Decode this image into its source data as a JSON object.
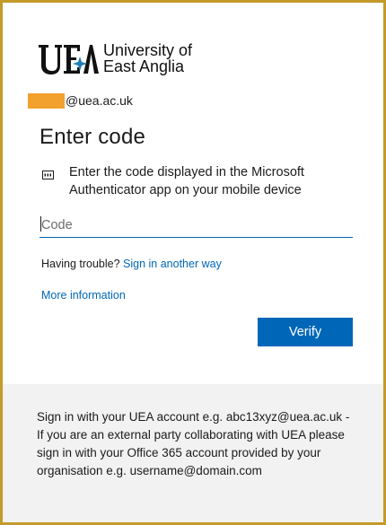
{
  "logo": {
    "mark": "UEA",
    "line1": "University of",
    "line2": "East Anglia"
  },
  "identity": {
    "email_domain": "@uea.ac.uk"
  },
  "page": {
    "title": "Enter code",
    "description": "Enter the code displayed in the Microsoft Authenticator app on your mobile device",
    "description_icon": "keypad-icon"
  },
  "code_input": {
    "placeholder": "Code",
    "value": ""
  },
  "help": {
    "trouble_prefix": "Having trouble?",
    "trouble_link": "Sign in another way",
    "more_info": "More information"
  },
  "actions": {
    "verify_label": "Verify"
  },
  "footer": {
    "text": "Sign in with your UEA account e.g. abc13xyz@uea.ac.uk - If you are an external party collaborating with UEA please sign in with your Office 365 account provided by your organisation e.g. username@domain.com"
  },
  "colors": {
    "accent": "#0067b8",
    "frame": "#c39b2a",
    "redaction": "#f2a12e",
    "footer_bg": "#f2f2f2"
  }
}
